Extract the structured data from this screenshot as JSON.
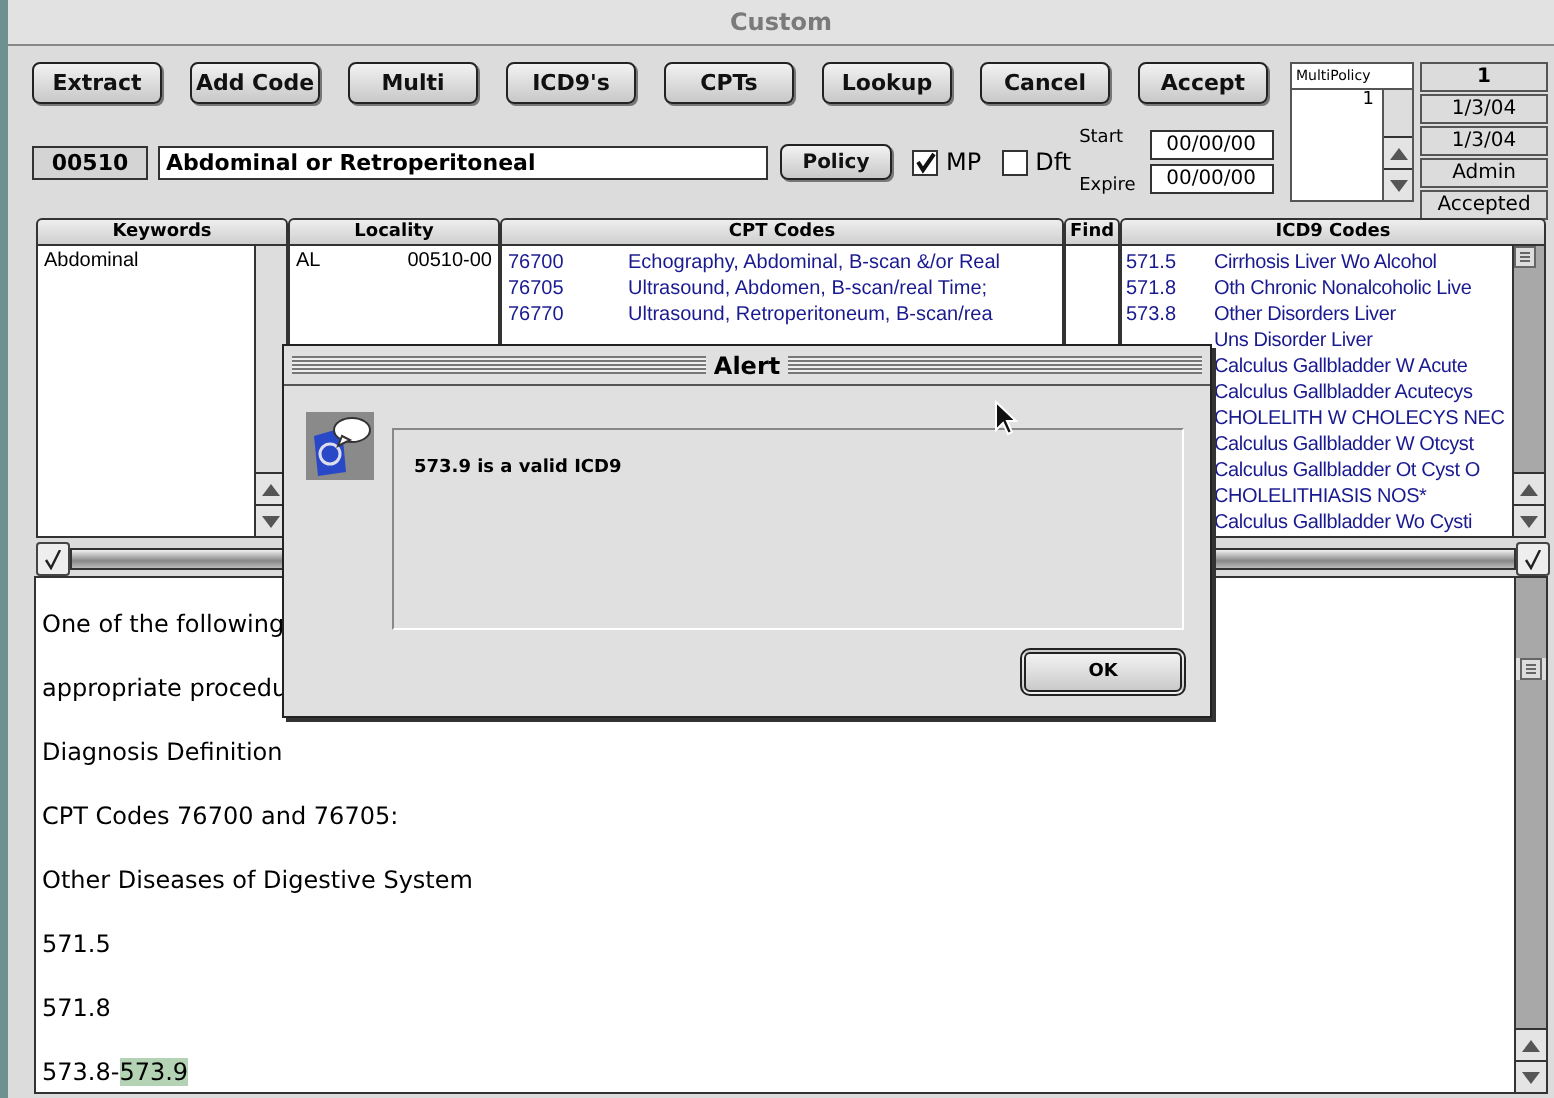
{
  "window": {
    "title": "Custom"
  },
  "toolbar": {
    "buttons": [
      "Extract",
      "Add Code",
      "Multi",
      "ICD9's",
      "CPTs",
      "Lookup",
      "Cancel",
      "Accept"
    ]
  },
  "policy_row": {
    "code": "00510",
    "description": "Abdominal or Retroperitoneal",
    "policy_button": "Policy",
    "checkboxes": [
      {
        "label": "MP",
        "checked": true
      },
      {
        "label": "Dft",
        "checked": false
      }
    ],
    "dates": [
      {
        "label": "Start",
        "value": "00/00/00"
      },
      {
        "label": "Expire",
        "value": "00/00/00"
      }
    ]
  },
  "multi_policy": {
    "title": "MultiPolicy",
    "items": [
      "1"
    ]
  },
  "status_panel": [
    "1",
    "1/3/04",
    "1/3/04",
    "Admin",
    "Accepted"
  ],
  "columns": [
    "Keywords",
    "Locality",
    "CPT Codes",
    "Find",
    "ICD9 Codes"
  ],
  "keywords": [
    "Abdominal"
  ],
  "localities": [
    {
      "state": "AL",
      "code": "00510-00"
    }
  ],
  "cpt_codes": [
    {
      "code": "76700",
      "description": "Echography, Abdominal, B-scan &/or Real"
    },
    {
      "code": "76705",
      "description": "Ultrasound, Abdomen, B-scan/real Time;"
    },
    {
      "code": "76770",
      "description": "Ultrasound, Retroperitoneum, B-scan/rea"
    }
  ],
  "icd9_codes": [
    {
      "code": "571.5",
      "description": "Cirrhosis Liver Wo Alcohol"
    },
    {
      "code": "571.8",
      "description": "Oth Chronic Nonalcoholic Live"
    },
    {
      "code": "573.8",
      "description": "Other Disorders Liver"
    },
    {
      "description": "Uns Disorder Liver"
    },
    {
      "description": "Calculus Gallbladder W Acute"
    },
    {
      "description": "Calculus Gallbladder Acutecys"
    },
    {
      "description": "CHOLELITH W CHOLECYS NEC"
    },
    {
      "description": "Calculus Gallbladder W Otcyst"
    },
    {
      "description": "Calculus Gallbladder Ot Cyst O"
    },
    {
      "description": "CHOLELITHIASIS NOS*"
    },
    {
      "description": "Calculus Gallbladder Wo Cysti"
    }
  ],
  "notes": [
    {
      "text": "One of the following"
    },
    {
      "text": "appropriate procedu"
    },
    {
      "text": "Diagnosis Definition"
    },
    {
      "text": "CPT Codes 76700 and 76705:"
    },
    {
      "text": "Other Diseases of Digestive System"
    },
    {
      "text": "571.5"
    },
    {
      "text": "571.8"
    },
    {
      "text": "573.8-",
      "selected_text": "573.9"
    }
  ],
  "alert": {
    "title": "Alert",
    "message": "573.9 is a valid ICD9",
    "button": "OK"
  }
}
